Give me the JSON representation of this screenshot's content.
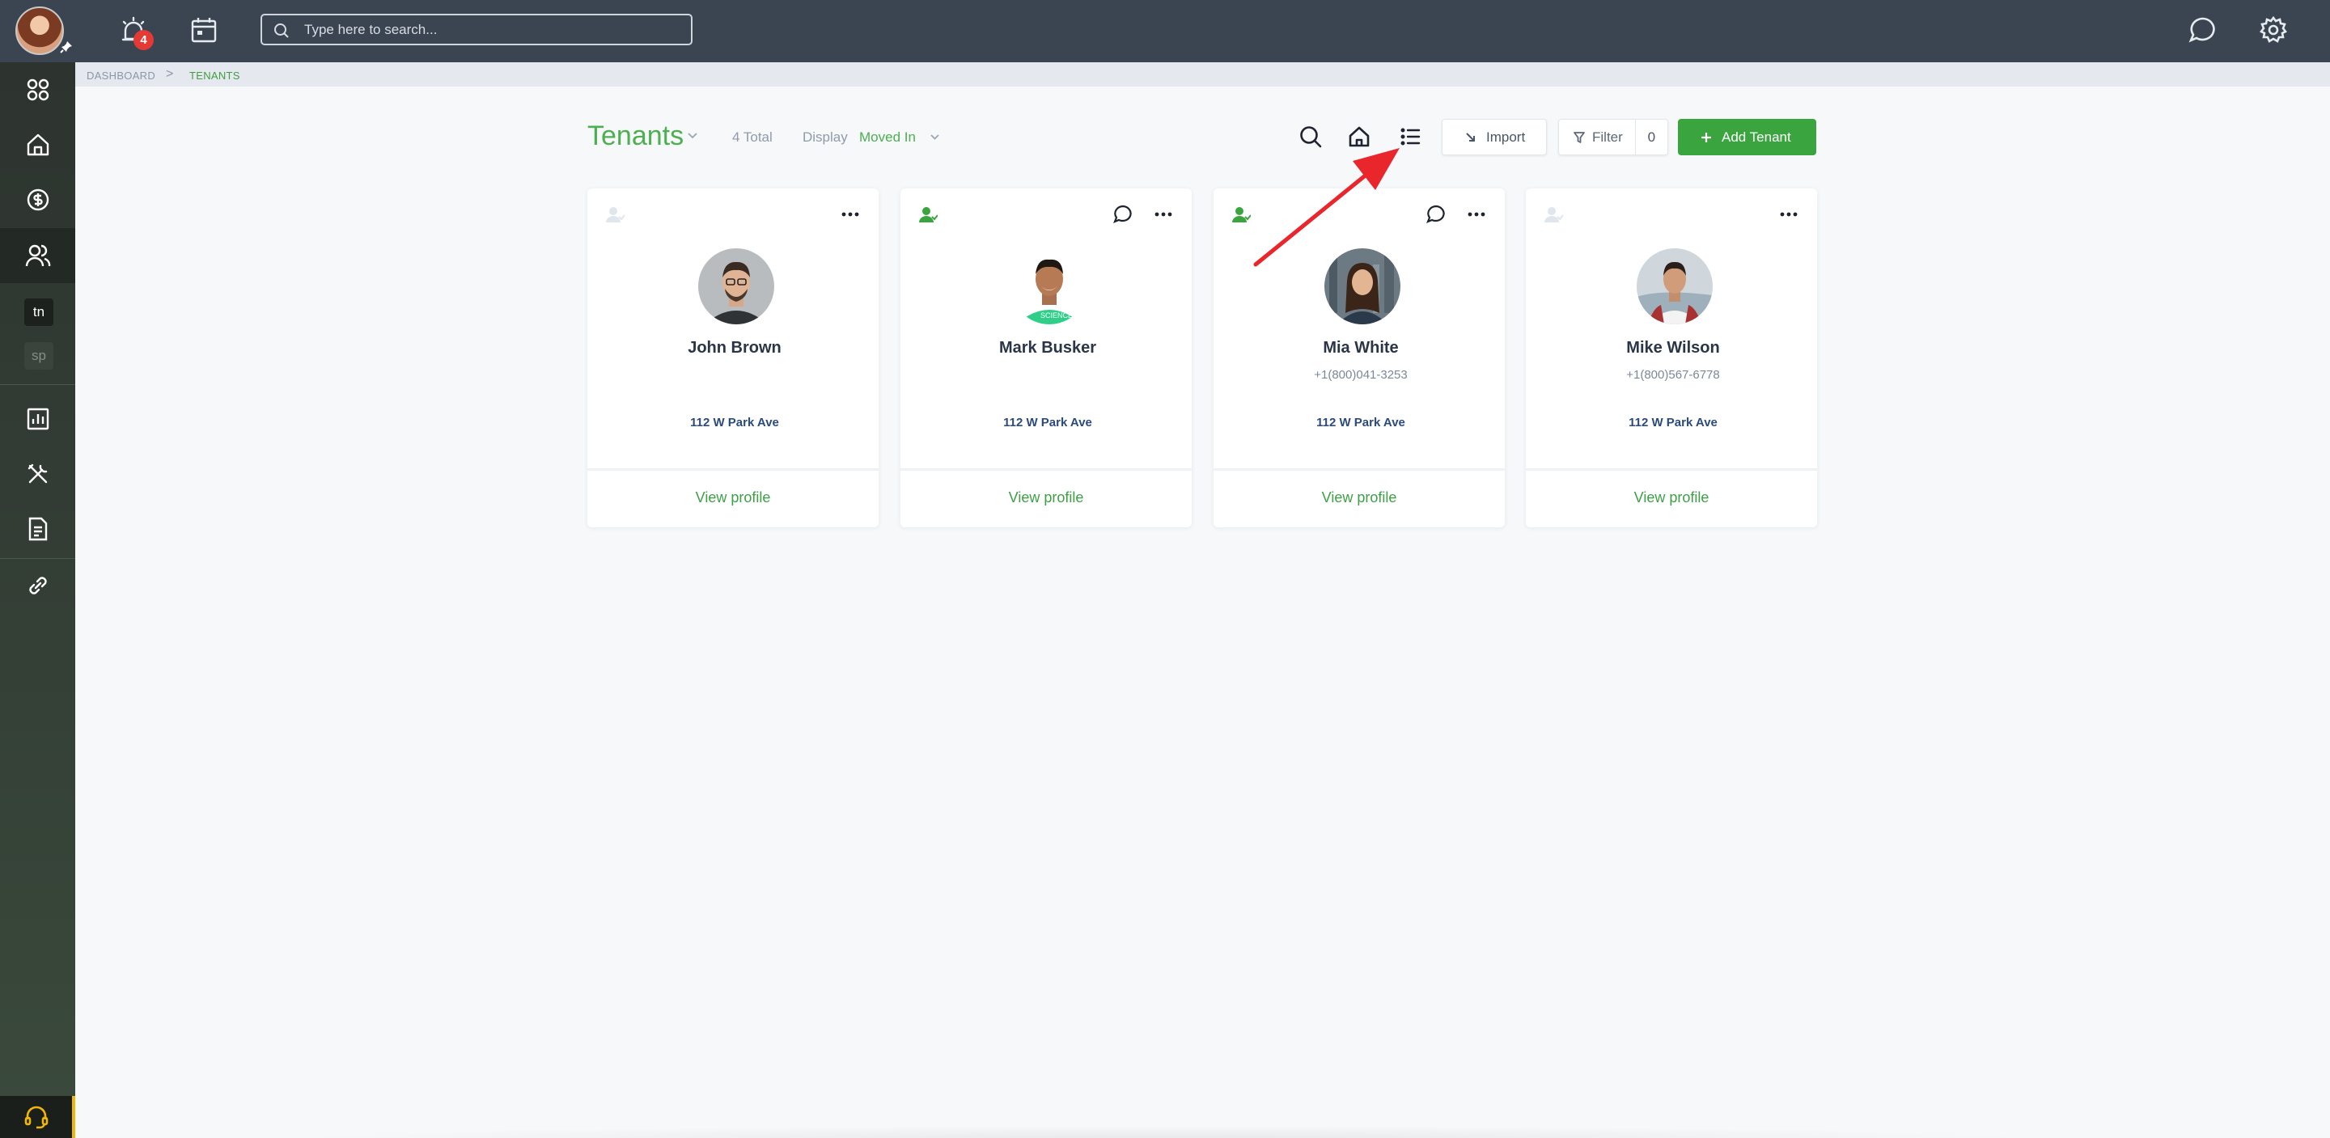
{
  "topbar": {
    "notifications_count": "4",
    "search_placeholder": "Type here to search..."
  },
  "sidebar": {
    "letter_items": [
      "tn",
      "sp"
    ]
  },
  "breadcrumb": {
    "items": [
      "DASHBOARD",
      "TENANTS"
    ],
    "separator": ">"
  },
  "header": {
    "title": "Tenants",
    "total": "4 Total",
    "display_label": "Display",
    "display_value": "Moved In",
    "import_label": "Import",
    "filter_label": "Filter",
    "filter_count": "0",
    "add_label": "Add Tenant"
  },
  "tenants": [
    {
      "name": "John Brown",
      "phone": "",
      "address": "112 W Park Ave",
      "link": "View profile",
      "active": false
    },
    {
      "name": "Mark Busker",
      "phone": "",
      "address": "112 W Park Ave",
      "link": "View profile",
      "active": true
    },
    {
      "name": "Mia White",
      "phone": "+1(800)041-3253",
      "address": "112 W Park Ave",
      "link": "View profile",
      "active": true
    },
    {
      "name": "Mike Wilson",
      "phone": "+1(800)567-6778",
      "address": "112 W Park Ave",
      "link": "View profile",
      "active": false
    }
  ],
  "colors": {
    "brand_green": "#4caf50",
    "topbar": "#3b4552",
    "annotation_arrow": "#e8262c"
  }
}
